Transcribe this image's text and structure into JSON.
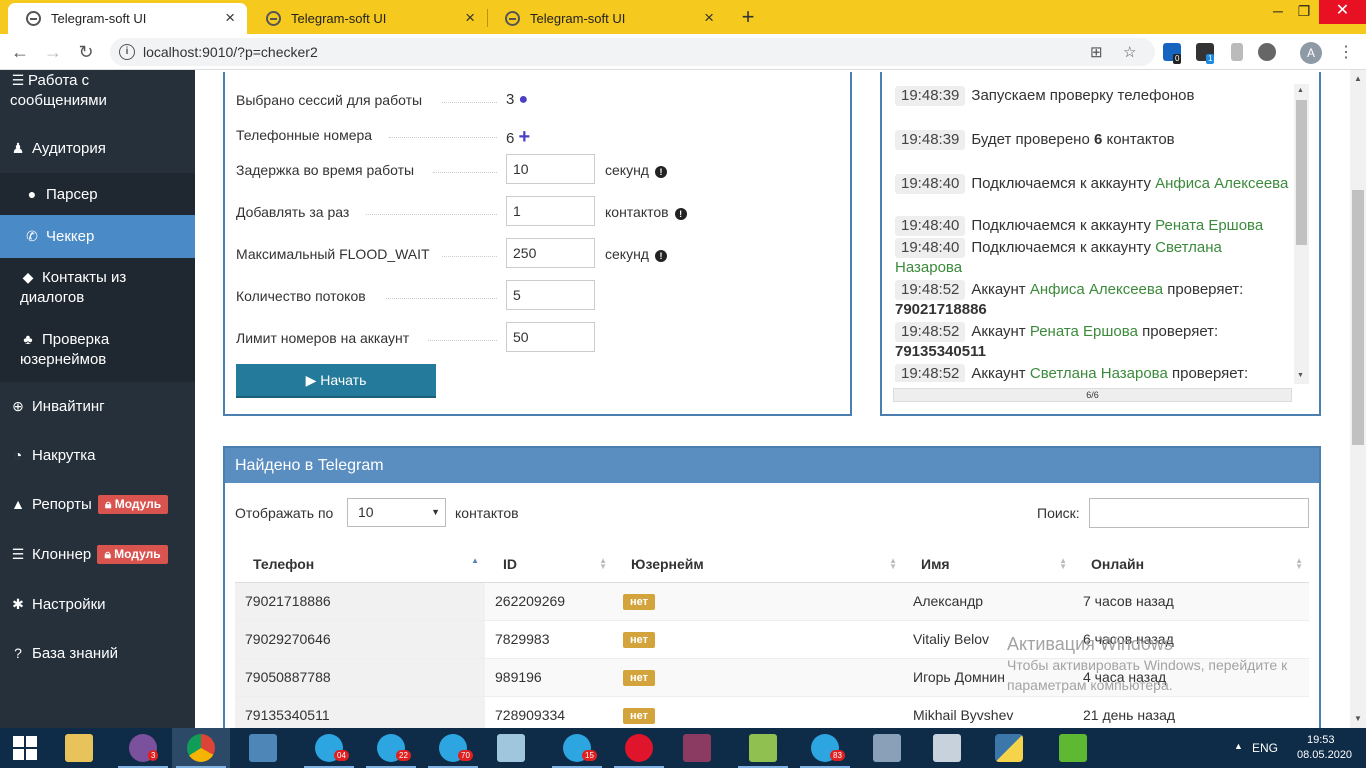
{
  "browser": {
    "tabs": [
      {
        "title": "Telegram-soft UI",
        "active": true
      },
      {
        "title": "Telegram-soft UI",
        "active": false
      },
      {
        "title": "Telegram-soft UI",
        "active": false
      }
    ],
    "url": "localhost:9010/?p=checker2",
    "profile_initial": "A",
    "extension_badges": [
      "0",
      "1"
    ]
  },
  "sidebar": {
    "items": [
      {
        "label": "Работа с сообщениями",
        "icon": "server-icon"
      },
      {
        "label": "Аудитория",
        "icon": "users-icon"
      },
      {
        "label": "Парсер",
        "icon": "user-icon"
      },
      {
        "label": "Чеккер",
        "icon": "phone-icon"
      },
      {
        "label": "Контакты из диалогов",
        "icon": "tags-icon"
      },
      {
        "label": "Проверка юзернеймов",
        "icon": "group-icon"
      },
      {
        "label": "Инвайтинг",
        "icon": "plus-circle-icon"
      },
      {
        "label": "Накрутка",
        "icon": "dashboard-icon"
      },
      {
        "label": "Репорты",
        "icon": "warning-icon"
      },
      {
        "label": "Клоннер",
        "icon": "server-icon"
      },
      {
        "label": "Настройки",
        "icon": "gear-icon"
      },
      {
        "label": "База знаний",
        "icon": "question-icon"
      }
    ],
    "module_badge": "Модуль"
  },
  "settings": {
    "sessions_label": "Выбрано сессий для работы",
    "sessions_value": "3",
    "phones_label": "Телефонные номера",
    "phones_value": "6",
    "delay_label": "Задержка во время работы",
    "delay_value": "10",
    "delay_unit": "секунд",
    "batch_label": "Добавлять за раз",
    "batch_value": "1",
    "batch_unit": "контактов",
    "flood_label": "Максимальный FLOOD_WAIT",
    "flood_value": "250",
    "flood_unit": "секунд",
    "threads_label": "Количество потоков",
    "threads_value": "5",
    "limit_label": "Лимит номеров на аккаунт",
    "limit_value": "50",
    "start_button": "Начать"
  },
  "log": {
    "lines": [
      {
        "time": "19:48:39",
        "text": "Запускаем проверку телефонов"
      },
      {
        "time": "19:48:39",
        "pre": "Будет проверено ",
        "bold": "6",
        "post": " контактов"
      },
      {
        "time": "19:48:40",
        "pre": "Подключаемся к аккаунту ",
        "account": "Анфиса Алексеева"
      },
      {
        "time": "19:48:40",
        "pre": "Подключаемся к аккаунту ",
        "account": "Рената Ершова"
      },
      {
        "time": "19:48:40",
        "pre": "Подключаемся к аккаунту ",
        "account": "Светлана Назарова"
      },
      {
        "time": "19:48:52",
        "pre": "Аккаунт ",
        "account": "Анфиса Алексеева",
        "post": " проверяет:",
        "bold": "79021718886"
      },
      {
        "time": "19:48:52",
        "pre": "Аккаунт ",
        "account": "Рената Ершова",
        "post": " проверяет:",
        "bold": "79135340511"
      },
      {
        "time": "19:48:52",
        "pre": "Аккаунт ",
        "account": "Светлана Назарова",
        "post": " проверяет:"
      }
    ],
    "progress_text": "6/6",
    "progress_fraction": 1.0
  },
  "results": {
    "title": "Найдено в Telegram",
    "show_prefix": "Отображать по",
    "show_value": "10",
    "show_suffix": "контактов",
    "search_label": "Поиск:",
    "columns": [
      "Телефон",
      "ID",
      "Юзернейм",
      "Имя",
      "Онлайн"
    ],
    "rows": [
      {
        "phone": "79021718886",
        "id": "262209269",
        "username": "нет",
        "name": "Александр",
        "online": "7 часов назад"
      },
      {
        "phone": "79029270646",
        "id": "7829983",
        "username": "нет",
        "name": "Vitaliy Belov",
        "online": "6 часов назад"
      },
      {
        "phone": "79050887788",
        "id": "989196",
        "username": "нет",
        "name": "Игорь Домнин",
        "online": "4 часа назад"
      },
      {
        "phone": "79135340511",
        "id": "728909334",
        "username": "нет",
        "name": "Mikhail Byvshev",
        "online": "21 день назад"
      }
    ]
  },
  "watermark": {
    "title": "Активация Windows",
    "line1": "Чтобы активировать Windows, перейдите к",
    "line2": "параметрам компьютера."
  },
  "taskbar": {
    "apps": [
      {
        "name": "windows-explorer",
        "badge": ""
      },
      {
        "name": "viber",
        "badge": "3"
      },
      {
        "name": "chrome",
        "badge": ""
      },
      {
        "name": "control-panel",
        "badge": ""
      },
      {
        "name": "telegram",
        "badge": "04"
      },
      {
        "name": "telegram",
        "badge": "22"
      },
      {
        "name": "telegram",
        "badge": "70"
      },
      {
        "name": "notepad",
        "badge": ""
      },
      {
        "name": "telegram",
        "badge": "15"
      },
      {
        "name": "opera",
        "badge": ""
      },
      {
        "name": "winrar",
        "badge": ""
      },
      {
        "name": "notepad-plus",
        "badge": ""
      },
      {
        "name": "telegram",
        "badge": "83"
      },
      {
        "name": "resource-monitor",
        "badge": ""
      },
      {
        "name": "calculator",
        "badge": ""
      },
      {
        "name": "python",
        "badge": ""
      },
      {
        "name": "camtasia",
        "badge": ""
      }
    ],
    "lang": "ENG",
    "time": "19:53",
    "date": "08.05.2020"
  }
}
